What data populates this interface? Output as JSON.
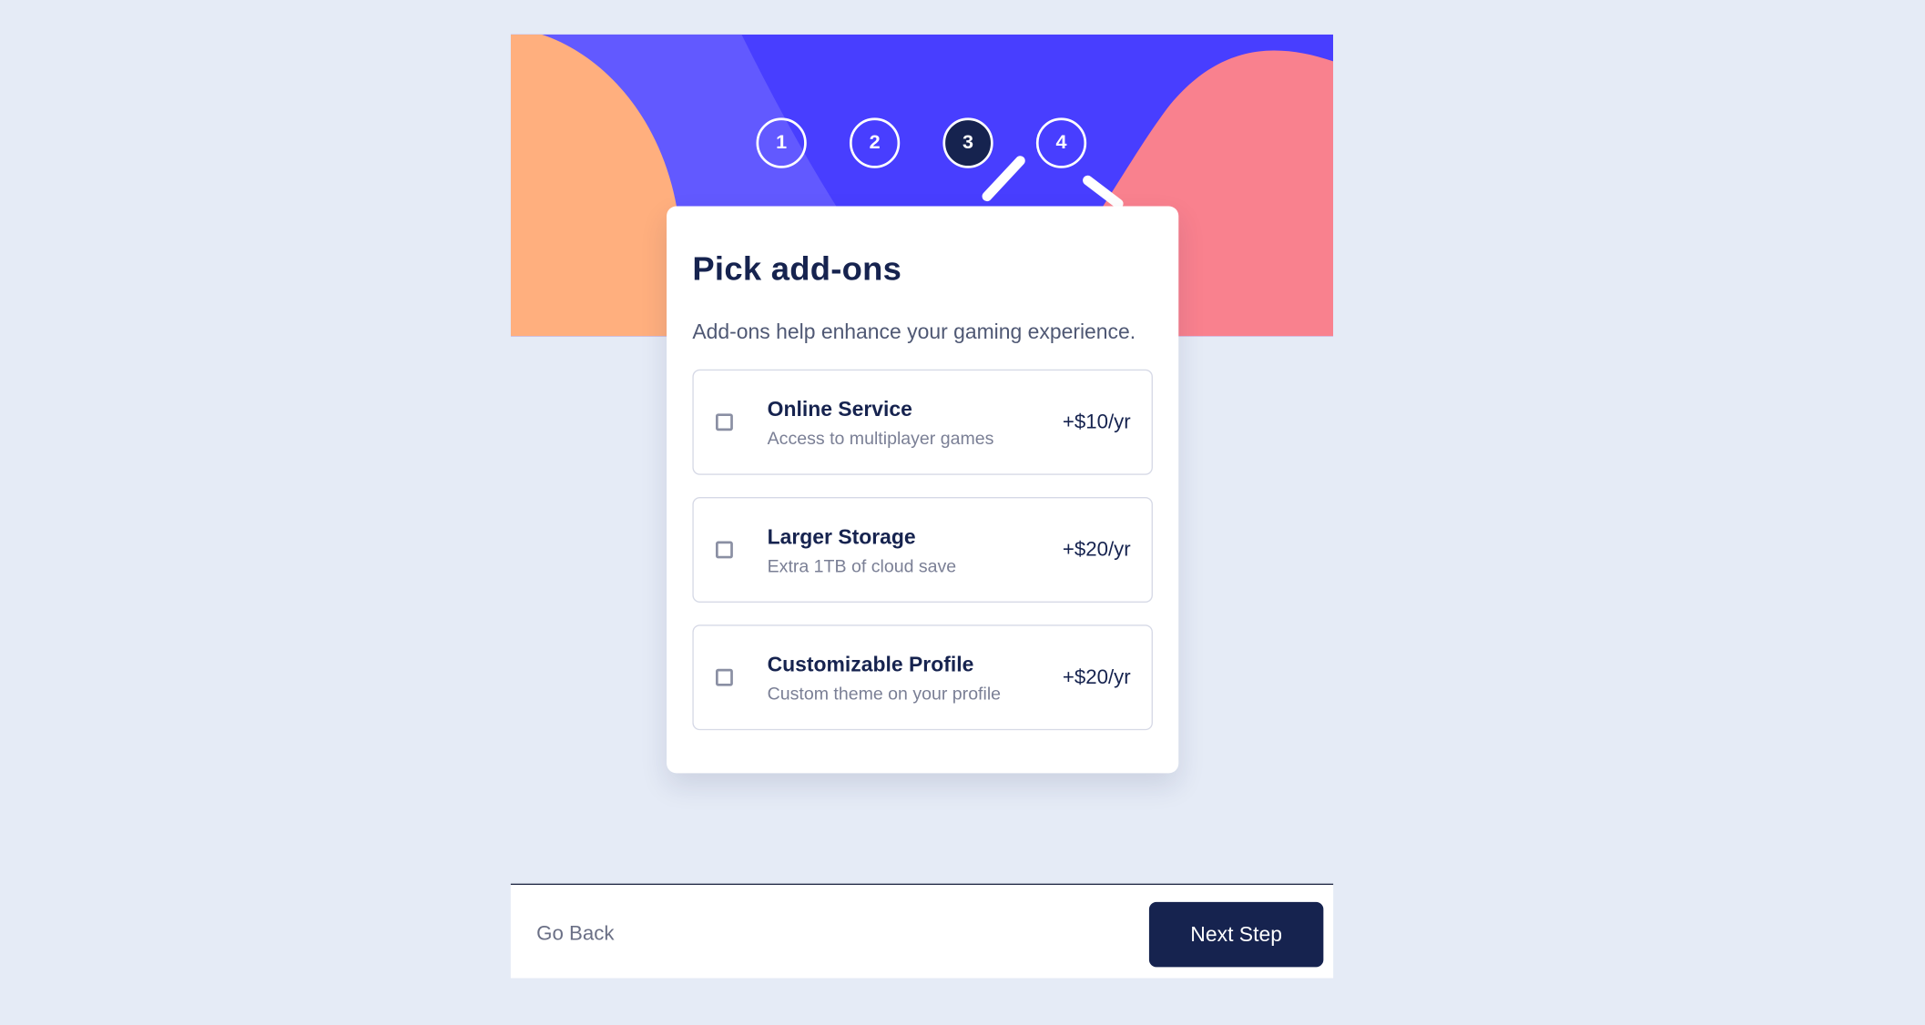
{
  "steps": [
    {
      "number": "1",
      "active": false
    },
    {
      "number": "2",
      "active": false
    },
    {
      "number": "3",
      "active": true
    },
    {
      "number": "4",
      "active": false
    }
  ],
  "card": {
    "title": "Pick add-ons",
    "subtitle": "Add-ons help enhance your gaming experience."
  },
  "addons": [
    {
      "name": "Online Service",
      "description": "Access to multiplayer games",
      "price": "+$10/yr",
      "checked": false
    },
    {
      "name": "Larger Storage",
      "description": "Extra 1TB of cloud save",
      "price": "+$20/yr",
      "checked": false
    },
    {
      "name": "Customizable Profile",
      "description": "Custom theme on your profile",
      "price": "+$20/yr",
      "checked": false
    }
  ],
  "footer": {
    "back_label": "Go Back",
    "next_label": "Next Step"
  },
  "colors": {
    "page_background": "#e5ebf6",
    "banner_primary": "#483eff",
    "banner_light": "#6259ff",
    "blob_orange": "#ffaf7e",
    "blob_pink": "#f9818e",
    "marine_blue": "#16234f"
  }
}
